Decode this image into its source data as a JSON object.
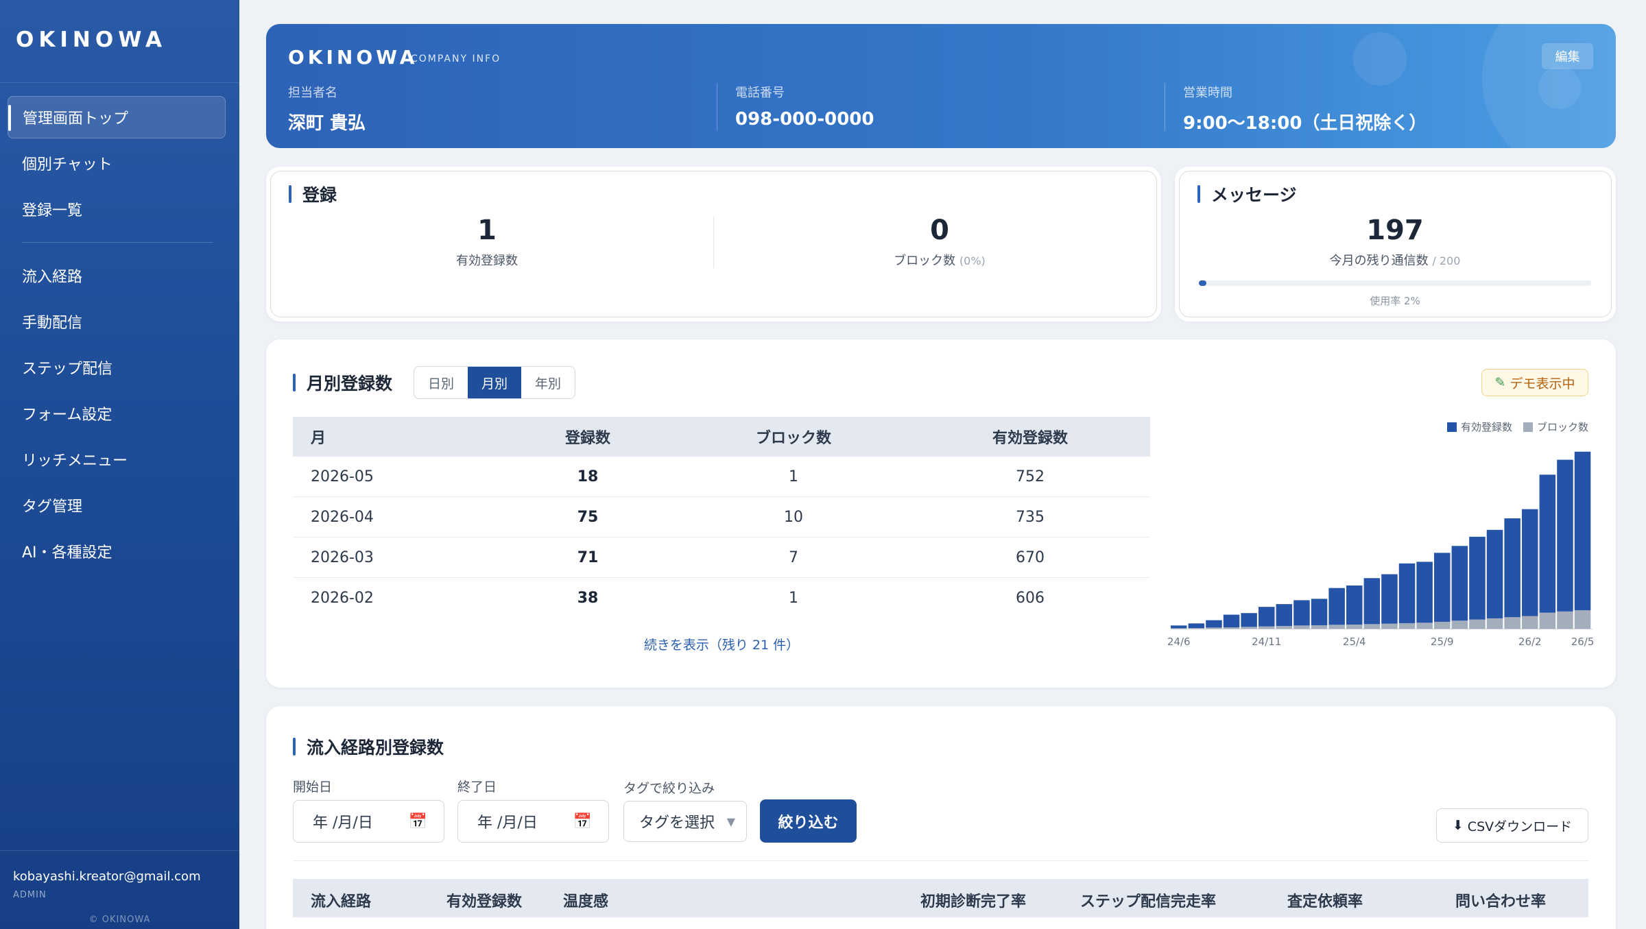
{
  "sidebar": {
    "brand": "OKINOWA",
    "items": [
      {
        "label": "管理画面トップ",
        "active": true
      },
      {
        "label": "個別チャット"
      },
      {
        "label": "登録一覧"
      },
      {
        "label": "流入経路"
      },
      {
        "label": "手動配信"
      },
      {
        "label": "ステップ配信"
      },
      {
        "label": "フォーム設定"
      },
      {
        "label": "リッチメニュー"
      },
      {
        "label": "タグ管理"
      },
      {
        "label": "AI・各種設定"
      }
    ],
    "user_email": "kobayashi.kreator@gmail.com",
    "user_role": "ADMIN",
    "copyright": "© OKINOWA"
  },
  "company": {
    "name": "OKINOWA",
    "subtitle": "COMPANY INFO",
    "edit_label": "編集",
    "contact_label": "担当者名",
    "contact_value": "深町 貴弘",
    "phone_label": "電話番号",
    "phone_value": "098-000-0000",
    "hours_label": "営業時間",
    "hours_value": "9:00〜18:00（土日祝除く）"
  },
  "registration": {
    "title": "登録",
    "active_count": "1",
    "active_label": "有効登録数",
    "block_count": "0",
    "block_label": "ブロック数",
    "block_pct": "(0%)"
  },
  "messages": {
    "title": "メッセージ",
    "remaining": "197",
    "remaining_label": "今月の残り通信数",
    "limit": "/ 200",
    "usage_label": "使用率 2%",
    "usage_fraction": 0.02
  },
  "monthly": {
    "title": "月別登録数",
    "tabs": [
      "日別",
      "月別",
      "年別"
    ],
    "active_tab": 1,
    "demo_label": "デモ表示中",
    "columns": [
      "月",
      "登録数",
      "ブロック数",
      "有効登録数"
    ],
    "rows": [
      [
        "2026-05",
        "18",
        "1",
        "752"
      ],
      [
        "2026-04",
        "75",
        "10",
        "735"
      ],
      [
        "2026-03",
        "71",
        "7",
        "670"
      ],
      [
        "2026-02",
        "38",
        "1",
        "606"
      ]
    ],
    "more_label": "続きを表示（残り 21 件）"
  },
  "chart_data": {
    "type": "bar",
    "stacked": true,
    "legend": [
      "有効登録数",
      "ブロック数"
    ],
    "legend_position": "top-right",
    "colors": {
      "active": "#2553a8",
      "blocked": "#a3adbb"
    },
    "x_tick_labels": [
      "24/6",
      "24/11",
      "25/4",
      "25/9",
      "26/2",
      "26/5"
    ],
    "x_tick_indices": [
      0,
      5,
      10,
      15,
      20,
      23
    ],
    "ymax": 850,
    "categories": [
      "24/6",
      "24/7",
      "24/8",
      "24/9",
      "24/10",
      "24/11",
      "24/12",
      "25/1",
      "25/2",
      "25/3",
      "25/4",
      "25/5",
      "25/6",
      "25/7",
      "25/8",
      "25/9",
      "25/10",
      "25/11",
      "25/12",
      "26/1",
      "26/2",
      "26/3",
      "26/4",
      "26/5"
    ],
    "series": [
      {
        "name": "有効登録数",
        "values": [
          12,
          20,
          32,
          55,
          60,
          85,
          95,
          110,
          115,
          160,
          170,
          200,
          215,
          260,
          265,
          300,
          325,
          360,
          385,
          430,
          465,
          600,
          660,
          690
        ]
      },
      {
        "name": "ブロック数",
        "values": [
          2,
          3,
          5,
          6,
          8,
          10,
          12,
          14,
          15,
          17,
          18,
          20,
          22,
          24,
          26,
          30,
          35,
          40,
          45,
          50,
          55,
          70,
          75,
          80
        ]
      }
    ]
  },
  "source": {
    "title": "流入経路別登録数",
    "start_label": "開始日",
    "end_label": "終了日",
    "tag_label": "タグで絞り込み",
    "date_placeholder": "年 /月/日",
    "tag_placeholder": "タグを選択",
    "filter_label": "絞り込む",
    "csv_label": "CSVダウンロード",
    "columns": [
      "流入経路",
      "有効登録数",
      "温度感",
      "初期診断完了率",
      "ステップ配信完走率",
      "査定依頼率",
      "問い合わせ率"
    ]
  }
}
